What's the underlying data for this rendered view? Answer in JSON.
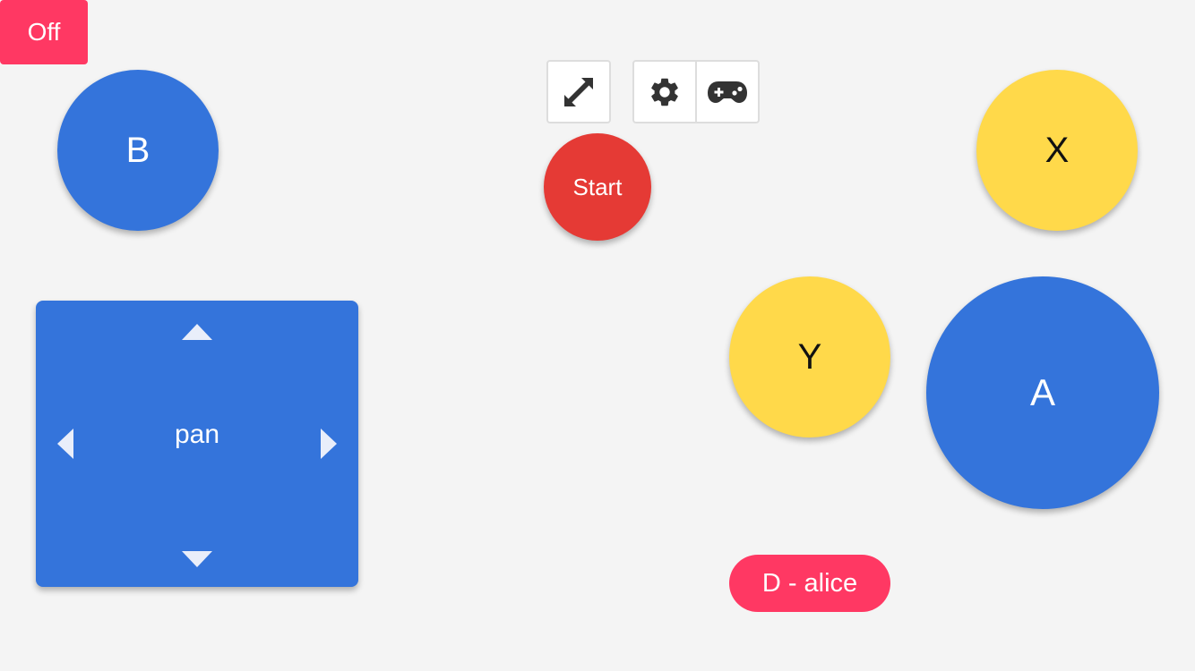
{
  "toolbar": {
    "power_label": "Off",
    "fullscreen_icon": "expand-arrows-icon",
    "settings_icon": "gear-icon",
    "controller_icon": "gamepad-icon"
  },
  "buttons": {
    "start": "Start",
    "b": "B",
    "x": "X",
    "y": "Y",
    "a": "A"
  },
  "dpad": {
    "label": "pan"
  },
  "player": {
    "label": "D - alice"
  },
  "colors": {
    "blue": "#3474db",
    "yellow": "#ffd94a",
    "start_red": "#e53a35",
    "accent_pink": "#ff3863",
    "background": "#f4f4f4"
  }
}
